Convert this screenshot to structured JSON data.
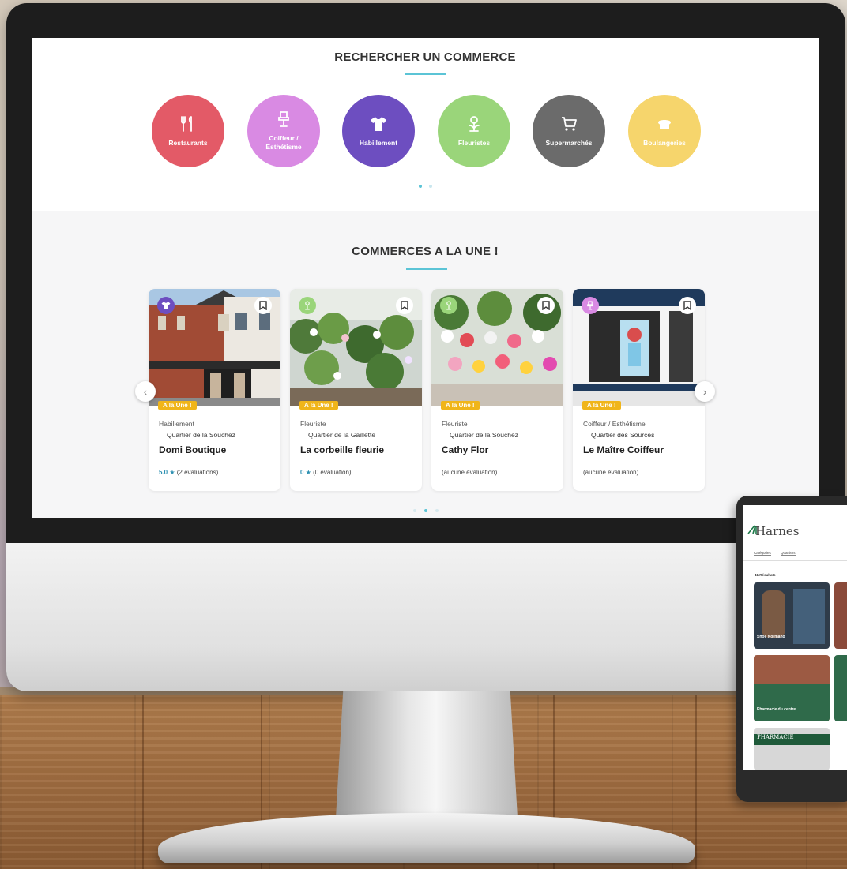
{
  "search": {
    "title": "RECHERCHER UN COMMERCE",
    "categories": [
      {
        "label": "Restaurants",
        "color": "#e35a67",
        "icon": "utensils-icon"
      },
      {
        "label": "Coiffeur / Esthétisme",
        "color": "#d98ae3",
        "icon": "chair-icon"
      },
      {
        "label": "Habillement",
        "color": "#6d4ec0",
        "icon": "tshirt-icon"
      },
      {
        "label": "Fleuristes",
        "color": "#9ad57a",
        "icon": "flower-icon"
      },
      {
        "label": "Supermarchés",
        "color": "#6b6b6b",
        "icon": "cart-icon"
      },
      {
        "label": "Boulangeries",
        "color": "#f6d56c",
        "icon": "bread-icon"
      }
    ]
  },
  "featured": {
    "title": "COMMERCES A LA UNE !",
    "badge": "A la Une !",
    "cards": [
      {
        "category": "Habillement",
        "quarter": "Quartier de la Souchez",
        "name": "Domi Boutique",
        "score": "5.0",
        "reviews": "(2 évaluations)",
        "icon_color": "#6d4ec0"
      },
      {
        "category": "Fleuriste",
        "quarter": "Quartier de la Gaillette",
        "name": "La corbeille fleurie",
        "score": "0",
        "reviews": "(0 évaluation)",
        "icon_color": "#9ad57a"
      },
      {
        "category": "Fleuriste",
        "quarter": "Quartier de la Souchez",
        "name": "Cathy Flor",
        "score": "",
        "reviews": "(aucune évaluation)",
        "icon_color": "#9ad57a"
      },
      {
        "category": "Coiffeur / Esthétisme",
        "quarter": "Quartier des Sources",
        "name": "Le Maître Coiffeur",
        "score": "",
        "reviews": "(aucune évaluation)",
        "icon_color": "#d98ae3"
      }
    ]
  },
  "tablet": {
    "logo": "Harnes",
    "filters": [
      "Catégories",
      "Quartiers"
    ],
    "results": "41 Résultats",
    "tiles": [
      {
        "title": "Shoé Normand",
        "sub": ""
      },
      {
        "title": "Pharmacie du centre",
        "sub": ""
      }
    ],
    "pharmacy_sign": "PHARMACIE"
  },
  "colors": {
    "accent": "#5bc4d6",
    "badge": "#f0b51a",
    "rating": "#2b8fb1"
  }
}
